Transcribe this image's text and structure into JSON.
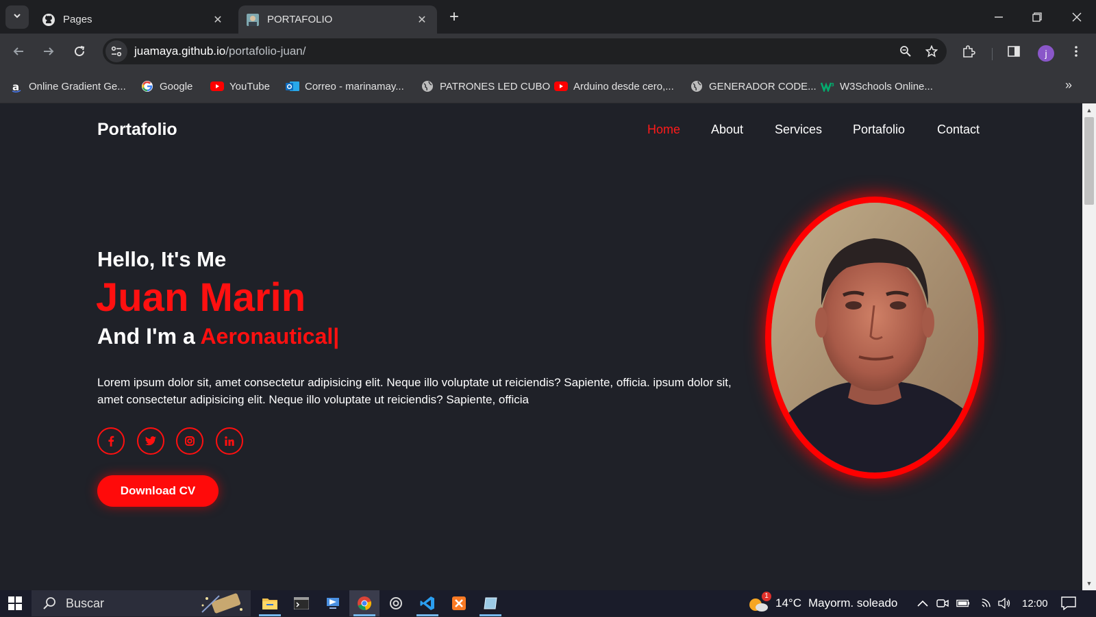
{
  "browser": {
    "tabs": [
      {
        "title": "Pages",
        "favicon": "github-icon",
        "active": false
      },
      {
        "title": "PORTAFOLIO",
        "favicon": "portrait-favicon",
        "active": true
      }
    ],
    "url_host": "juamaya.github.io",
    "url_path": "/portafolio-juan/",
    "profile_initial": "j",
    "bookmarks": [
      {
        "label": "Online Gradient Ge...",
        "icon": "a-icon"
      },
      {
        "label": "Google",
        "icon": "google-icon"
      },
      {
        "label": "YouTube",
        "icon": "youtube-icon"
      },
      {
        "label": "Correo - marinamay...",
        "icon": "outlook-icon"
      },
      {
        "label": "PATRONES LED CUBO",
        "icon": "globe-icon"
      },
      {
        "label": "Arduino desde cero,...",
        "icon": "youtube-icon"
      },
      {
        "label": "GENERADOR CODE...",
        "icon": "globe-icon"
      },
      {
        "label": "W3Schools Online...",
        "icon": "w3schools-icon"
      }
    ]
  },
  "site": {
    "logo": "Portafolio",
    "nav": [
      {
        "label": "Home",
        "active": true
      },
      {
        "label": "About",
        "active": false
      },
      {
        "label": "Services",
        "active": false
      },
      {
        "label": "Portafolio",
        "active": false
      },
      {
        "label": "Contact",
        "active": false
      }
    ],
    "hero": {
      "greeting": "Hello, It's Me",
      "name": "Juan Marin",
      "intro": "And I'm a ",
      "role": "Aeronautical",
      "caret": "|",
      "bio": "Lorem ipsum dolor sit, amet consectetur adipisicing elit. Neque illo voluptate ut reiciendis? Sapiente, officia. ipsum dolor sit, amet consectetur adipisicing elit. Neque illo voluptate ut reiciendis? Sapiente, officia",
      "social": [
        {
          "label": "f",
          "icon": "facebook-icon"
        },
        {
          "label": "t",
          "icon": "twitter-icon"
        },
        {
          "label": "ig",
          "icon": "instagram-icon"
        },
        {
          "label": "in",
          "icon": "linkedin-icon"
        }
      ],
      "cta": "Download CV"
    },
    "accent": "#ff0a0a",
    "background": "#1f2128"
  },
  "taskbar": {
    "search_placeholder": "Buscar",
    "weather_temp": "14°C",
    "weather_desc": "Mayorm. soleado",
    "weather_badge": "1",
    "time": "12:00"
  }
}
